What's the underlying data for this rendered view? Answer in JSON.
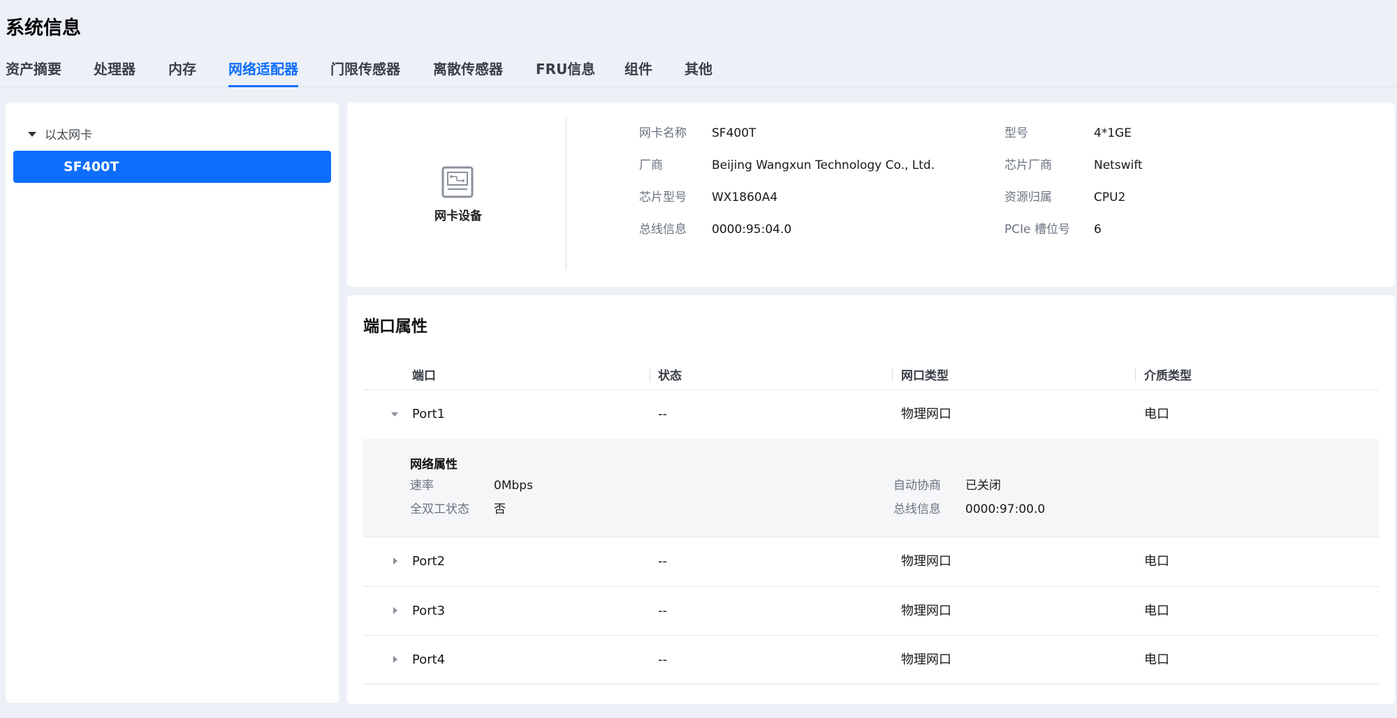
{
  "page_title": "系统信息",
  "tabs": [
    {
      "label": "资产摘要"
    },
    {
      "label": "处理器"
    },
    {
      "label": "内存"
    },
    {
      "label": "网络适配器"
    },
    {
      "label": "门限传感器"
    },
    {
      "label": "离散传感器"
    },
    {
      "label": "FRU信息"
    },
    {
      "label": "组件"
    },
    {
      "label": "其他"
    }
  ],
  "active_tab": "网络适配器",
  "tree": {
    "group_label": "以太网卡",
    "items": [
      {
        "label": "SF400T",
        "selected": true
      }
    ]
  },
  "device": {
    "icon": "network-card-icon",
    "label": "网卡设备",
    "fields": {
      "name": {
        "key": "网卡名称",
        "value": "SF400T"
      },
      "model": {
        "key": "型号",
        "value": "4*1GE"
      },
      "vendor": {
        "key": "厂商",
        "value": "Beijing Wangxun Technology Co., Ltd."
      },
      "chip_vendor": {
        "key": "芯片厂商",
        "value": "Netswift"
      },
      "chip_model": {
        "key": "芯片型号",
        "value": "WX1860A4"
      },
      "resource": {
        "key": "资源归属",
        "value": "CPU2"
      },
      "bus": {
        "key": "总线信息",
        "value": "0000:95:04.0"
      },
      "pcie_slot": {
        "key": "PCIe 槽位号",
        "value": "6"
      }
    }
  },
  "ports": {
    "title": "端口属性",
    "columns": [
      "端口",
      "状态",
      "网口类型",
      "介质类型"
    ],
    "rows": [
      {
        "port": "Port1",
        "status": "--",
        "net_type": "物理网口",
        "media": "电口",
        "expanded": true
      },
      {
        "port": "Port2",
        "status": "--",
        "net_type": "物理网口",
        "media": "电口",
        "expanded": false
      },
      {
        "port": "Port3",
        "status": "--",
        "net_type": "物理网口",
        "media": "电口",
        "expanded": false
      },
      {
        "port": "Port4",
        "status": "--",
        "net_type": "物理网口",
        "media": "电口",
        "expanded": false
      }
    ],
    "detail": {
      "title": "网络属性",
      "speed": {
        "key": "速率",
        "value": "0Mbps"
      },
      "auto_neg": {
        "key": "自动协商",
        "value": "已关闭"
      },
      "full_duplex": {
        "key": "全双工状态",
        "value": "否"
      },
      "bus": {
        "key": "总线信息",
        "value": "0000:97:00.0"
      }
    }
  },
  "colors": {
    "accent": "#0d6efd",
    "background": "#edf1f7",
    "panel": "#ffffff"
  }
}
